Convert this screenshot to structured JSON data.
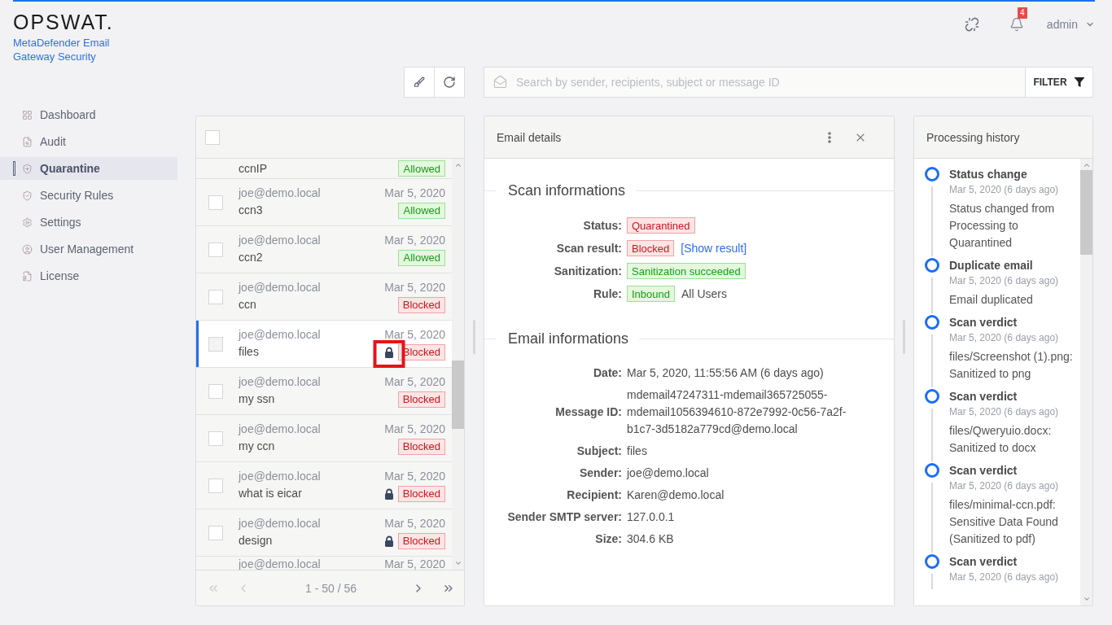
{
  "branding": {
    "logo": "OPSWAT.",
    "product": "MetaDefender Email Gateway Security"
  },
  "header": {
    "notification_count": "4",
    "user": "admin"
  },
  "sidebar": {
    "items": [
      {
        "label": "Dashboard",
        "selected": false
      },
      {
        "label": "Audit",
        "selected": false
      },
      {
        "label": "Quarantine",
        "selected": true
      },
      {
        "label": "Security Rules",
        "selected": false
      },
      {
        "label": "Settings",
        "selected": false
      },
      {
        "label": "User Management",
        "selected": false
      },
      {
        "label": "License",
        "selected": false
      }
    ]
  },
  "toolbar": {
    "search": {
      "placeholder": "Search by sender, recipients, subject or message ID"
    },
    "filter_button": "FILTER"
  },
  "email_list": {
    "select_all": {
      "checked": false
    },
    "rows": [
      {
        "subject": "ccnIP",
        "status": {
          "label": "Allowed",
          "kind": "success"
        },
        "locked": false,
        "selected": false,
        "highlighted": false
      },
      {
        "sender": "joe@demo.local",
        "date": "Mar 5, 2020",
        "subject": "ccn3",
        "status": {
          "label": "Allowed",
          "kind": "success"
        },
        "checked": false,
        "locked": false,
        "selected": false,
        "highlighted": false
      },
      {
        "sender": "joe@demo.local",
        "date": "Mar 5, 2020",
        "subject": "ccn2",
        "status": {
          "label": "Allowed",
          "kind": "success"
        },
        "checked": false,
        "locked": false,
        "selected": false,
        "highlighted": false
      },
      {
        "sender": "joe@demo.local",
        "date": "Mar 5, 2020",
        "subject": "ccn",
        "status": {
          "label": "Blocked",
          "kind": "danger"
        },
        "checked": false,
        "locked": false,
        "selected": false,
        "highlighted": false
      },
      {
        "sender": "joe@demo.local",
        "date": "Mar 5, 2020",
        "subject": "files",
        "status": {
          "label": "Blocked",
          "kind": "danger"
        },
        "checked": false,
        "locked": true,
        "selected": true,
        "highlighted": true
      },
      {
        "sender": "joe@demo.local",
        "date": "Mar 5, 2020",
        "subject": "my ssn",
        "status": {
          "label": "Blocked",
          "kind": "danger"
        },
        "checked": false,
        "locked": false,
        "selected": false,
        "highlighted": false
      },
      {
        "sender": "joe@demo.local",
        "date": "Mar 5, 2020",
        "subject": "my ccn",
        "status": {
          "label": "Blocked",
          "kind": "danger"
        },
        "checked": false,
        "locked": false,
        "selected": false,
        "highlighted": false
      },
      {
        "sender": "joe@demo.local",
        "date": "Mar 5, 2020",
        "subject": "what is eicar",
        "status": {
          "label": "Blocked",
          "kind": "danger"
        },
        "checked": false,
        "locked": true,
        "selected": false,
        "highlighted": false
      },
      {
        "sender": "joe@demo.local",
        "date": "Mar 5, 2020",
        "subject": "design",
        "status": {
          "label": "Blocked",
          "kind": "danger"
        },
        "checked": false,
        "locked": true,
        "selected": false,
        "highlighted": false
      },
      {
        "sender": "joe@demo.local",
        "date": "Mar 5, 2020",
        "selected": false
      }
    ],
    "pagination": {
      "range": "1 - 50 / 56",
      "buttons": [
        {
          "kind": "first",
          "disabled": true
        },
        {
          "kind": "previous",
          "disabled": true
        },
        {
          "kind": "next",
          "disabled": false
        },
        {
          "kind": "last",
          "disabled": false
        }
      ]
    }
  },
  "details": {
    "title": "Email details",
    "sections": [
      {
        "title": "Scan informations",
        "fields": [
          {
            "label": "Status:",
            "badges": [
              {
                "label": "Quarantined",
                "kind": "danger"
              }
            ]
          },
          {
            "label": "Scan result:",
            "badges": [
              {
                "label": "Blocked",
                "kind": "danger"
              }
            ],
            "link": "[Show result]"
          },
          {
            "label": "Sanitization:",
            "badges": [
              {
                "label": "Sanitization succeeded",
                "kind": "success"
              }
            ]
          },
          {
            "label": "Rule:",
            "badges": [
              {
                "label": "Inbound",
                "kind": "success"
              }
            ],
            "text": "All Users"
          }
        ]
      },
      {
        "title": "Email informations",
        "fields": [
          {
            "label": "Date:",
            "text": "Mar 5, 2020, 11:55:56 AM (6 days ago)"
          },
          {
            "label": "Message ID:",
            "text": "mdemail47247311-mdemail365725055-mdemail1056394610-872e7992-0c56-7a2f-b1c7-3d5182a779cd@demo.local"
          },
          {
            "label": "Subject:",
            "text": "files"
          },
          {
            "label": "Sender:",
            "text": "joe@demo.local"
          },
          {
            "label": "Recipient:",
            "text": "Karen@demo.local"
          },
          {
            "label": "Sender SMTP server:",
            "text": "127.0.0.1"
          },
          {
            "label": "Size:",
            "text": "304.6 KB"
          }
        ]
      }
    ]
  },
  "history": {
    "title": "Processing history",
    "events": [
      {
        "title": "Status change",
        "date": "Mar 5, 2020 (6 days ago)",
        "description": "Status changed from Processing to Quarantined"
      },
      {
        "title": "Duplicate email",
        "date": "Mar 5, 2020 (6 days ago)",
        "description": "Email duplicated"
      },
      {
        "title": "Scan verdict",
        "date": "Mar 5, 2020 (6 days ago)",
        "description": "files/Screenshot (1).png: Sanitized to png"
      },
      {
        "title": "Scan verdict",
        "date": "Mar 5, 2020 (6 days ago)",
        "description": "files/Qweryuio.docx: Sanitized to docx"
      },
      {
        "title": "Scan verdict",
        "date": "Mar 5, 2020 (6 days ago)",
        "description": "files/minimal-ccn.pdf: Sensitive Data Found (Sanitized to pdf)"
      },
      {
        "title": "Scan verdict",
        "date": "Mar 5, 2020 (6 days ago)"
      }
    ]
  }
}
